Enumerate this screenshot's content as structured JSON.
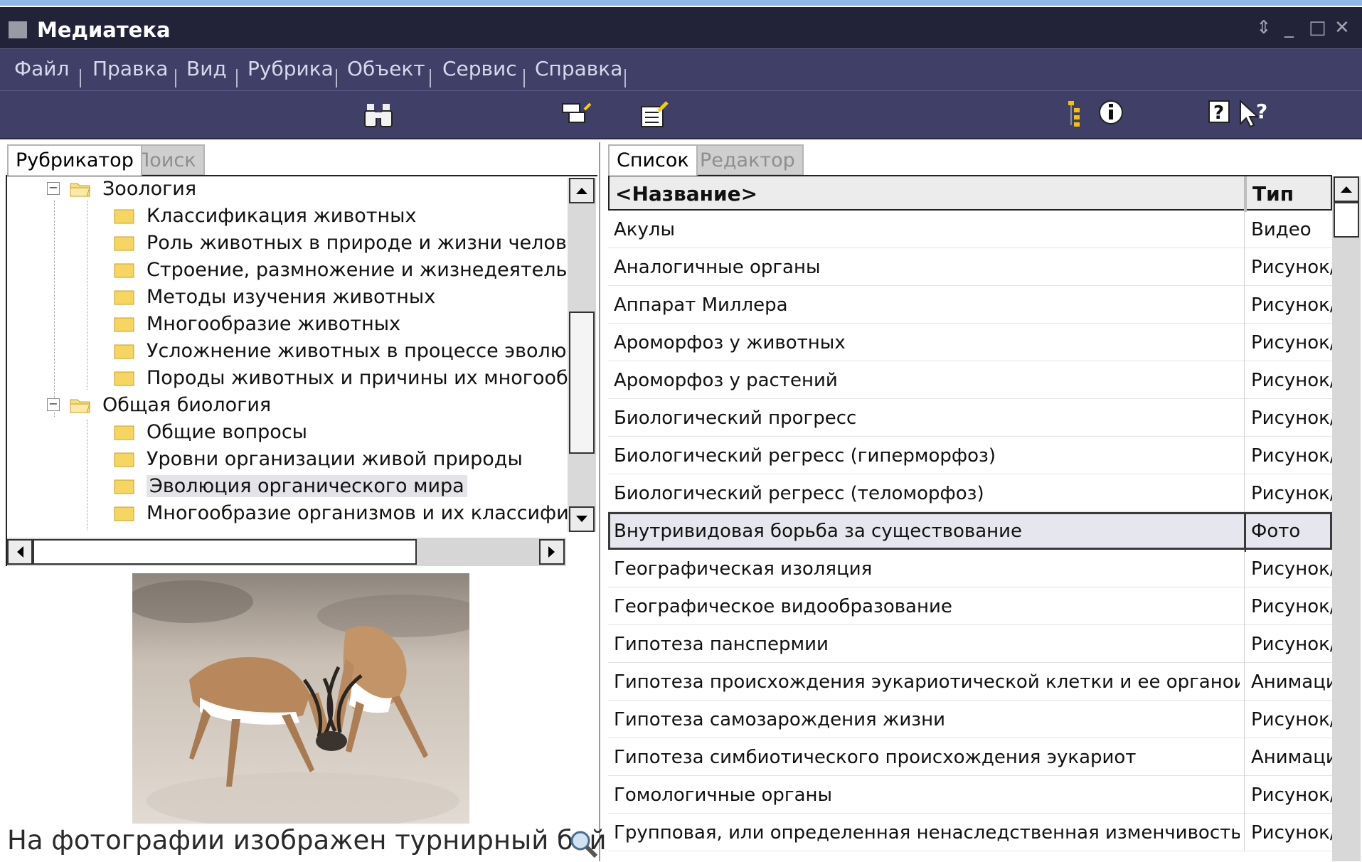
{
  "window": {
    "title": "Медиатека"
  },
  "menu": {
    "items": [
      "Файл",
      "Правка",
      "Вид",
      "Рубрика",
      "Объект",
      "Сервис",
      "Справка"
    ]
  },
  "toolbar": {
    "icons": [
      "binoculars-icon",
      "window-edit-icon",
      "clipboard-edit-icon",
      "tree-view-icon",
      "info-icon",
      "help-icon",
      "whats-this-icon"
    ]
  },
  "left_tabs": {
    "items": [
      "Рубрикатор",
      "Поиск"
    ],
    "active": "Рубрикатор"
  },
  "right_tabs": {
    "items": [
      "Список",
      "Редактор"
    ],
    "active": "Список"
  },
  "tree": {
    "nodes": [
      {
        "label": "Зоология",
        "level": 1,
        "expanded": true
      },
      {
        "label": "Классификация животных",
        "level": 2
      },
      {
        "label": "Роль животных в природе и жизни человека, охр",
        "level": 2
      },
      {
        "label": "Строение, размножение и жизнедеятельность ж",
        "level": 2
      },
      {
        "label": "Методы изучения животных",
        "level": 2
      },
      {
        "label": "Многообразие животных",
        "level": 2
      },
      {
        "label": "Усложнение животных в процессе эволюции",
        "level": 2
      },
      {
        "label": "Породы животных и причины их многообразия, с",
        "level": 2
      },
      {
        "label": "Общая биология",
        "level": 1,
        "expanded": true
      },
      {
        "label": "Общие вопросы",
        "level": 2
      },
      {
        "label": "Уровни организации живой природы",
        "level": 2
      },
      {
        "label": "Эволюция органического мира",
        "level": 2,
        "selected": true
      },
      {
        "label": "Многообразие организмов и их классификация",
        "level": 2
      }
    ]
  },
  "preview": {
    "caption": "На фотографии изображен турнирный бой"
  },
  "list": {
    "columns": {
      "name": "<Название>",
      "type": "Тип"
    },
    "rows": [
      {
        "name": "Акулы",
        "type": "Видео"
      },
      {
        "name": "Аналогичные органы",
        "type": "Рисунок/"
      },
      {
        "name": "Аппарат Миллера",
        "type": "Рисунок/"
      },
      {
        "name": "Ароморфоз у животных",
        "type": "Рисунок/"
      },
      {
        "name": "Ароморфоз у растений",
        "type": "Рисунок/"
      },
      {
        "name": "Биологический прогресс",
        "type": "Рисунок/"
      },
      {
        "name": "Биологический регресс (гиперморфоз)",
        "type": "Рисунок/"
      },
      {
        "name": "Биологический регресс (теломорфоз)",
        "type": "Рисунок/"
      },
      {
        "name": "Внутривидовая борьба за существование",
        "type": "Фото",
        "selected": true
      },
      {
        "name": "Географическая изоляция",
        "type": "Рисунок/"
      },
      {
        "name": "Географическое видообразование",
        "type": "Рисунок/"
      },
      {
        "name": "Гипотеза панспермии",
        "type": "Рисунок/"
      },
      {
        "name": "Гипотеза происхождения эукариотической клетки и ее органоидов путе",
        "type": "Анимаци"
      },
      {
        "name": "Гипотеза самозарождения жизни",
        "type": "Рисунок/"
      },
      {
        "name": "Гипотеза симбиотического происхождения эукариот",
        "type": "Анимаци"
      },
      {
        "name": "Гомологичные органы",
        "type": "Рисунок/"
      },
      {
        "name": "Групповая, или определенная ненаследственная изменчивость",
        "type": "Рисунок/"
      }
    ]
  },
  "colors": {
    "titlebar": "#222238",
    "menubar": "#3f3f67",
    "selection": "#e6e6ee",
    "folder": "#f4cc46"
  }
}
